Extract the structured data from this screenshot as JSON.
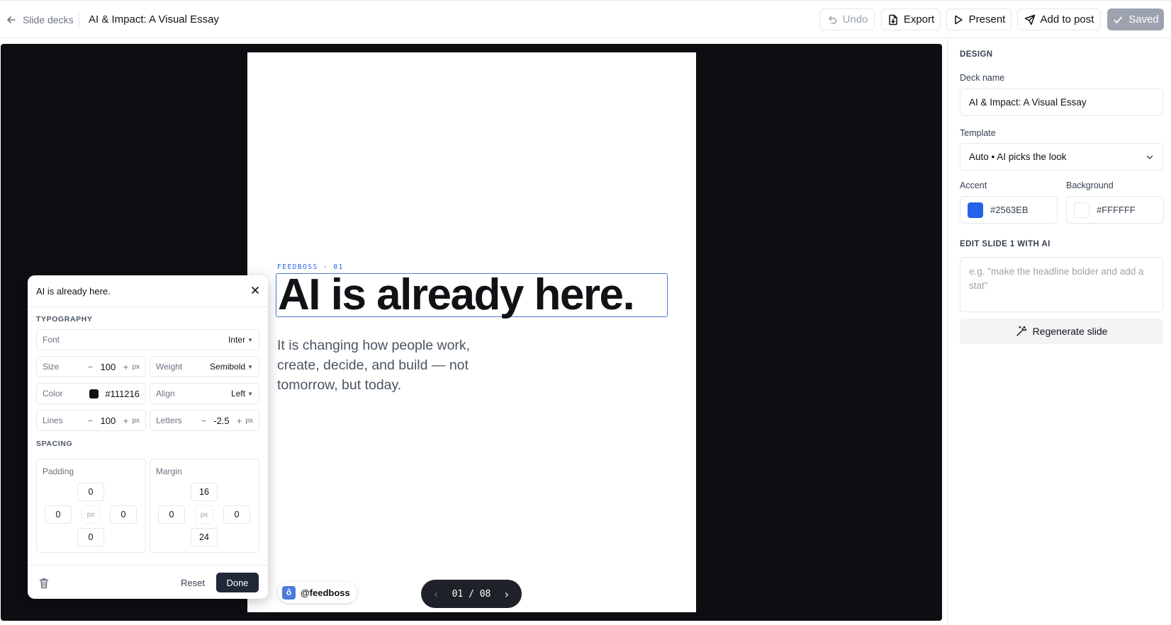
{
  "header": {
    "back_label": "Slide decks",
    "deck_title": "AI & Impact: A Visual Essay",
    "undo_label": "Undo",
    "export_label": "Export",
    "present_label": "Present",
    "add_to_post_label": "Add to post",
    "saved_label": "Saved"
  },
  "slide": {
    "eyebrow": "FEEDBOSS · 01",
    "headline": "AI is already here.",
    "subhead": "It is changing how people work, create, decide, and build — not tomorrow, but today.",
    "handle": "@feedboss",
    "handle_logo": "ô"
  },
  "pager": {
    "current": "01",
    "separator": "/",
    "total": "08",
    "prev": "‹",
    "next": "›"
  },
  "edit_panel": {
    "title": "AI is already here.",
    "typography_label": "TYPOGRAPHY",
    "font": {
      "label": "Font",
      "value": "Inter"
    },
    "size": {
      "label": "Size",
      "value": "100",
      "unit": "px"
    },
    "weight": {
      "label": "Weight",
      "value": "Semibold"
    },
    "color": {
      "label": "Color",
      "value": "#111216"
    },
    "align": {
      "label": "Align",
      "value": "Left"
    },
    "lines": {
      "label": "Lines",
      "value": "100",
      "unit": "px"
    },
    "letters": {
      "label": "Letters",
      "value": "-2.5",
      "unit": "px"
    },
    "spacing_label": "SPACING",
    "padding": {
      "label": "Padding",
      "top": "0",
      "left": "0",
      "right": "0",
      "bottom": "0",
      "unit": "px"
    },
    "margin": {
      "label": "Margin",
      "top": "16",
      "left": "0",
      "right": "0",
      "bottom": "24",
      "unit": "px"
    },
    "reset_label": "Reset",
    "done_label": "Done",
    "minus": "−",
    "plus": "+"
  },
  "sidebar": {
    "design_label": "DESIGN",
    "deck_name_label": "Deck name",
    "deck_name_value": "AI & Impact: A Visual Essay",
    "template_label": "Template",
    "template_value": "Auto • AI picks the look",
    "accent_label": "Accent",
    "accent_value": "#2563EB",
    "background_label": "Background",
    "background_value": "#FFFFFF",
    "edit_ai_label": "EDIT SLIDE 1 WITH AI",
    "edit_ai_placeholder": "e.g. \"make the headline bolder and add a stat\"",
    "regenerate_label": "Regenerate slide"
  },
  "colors": {
    "stage_bg": "#0d0e12",
    "accent": "#2563EB",
    "text": "#111216",
    "saved_bg": "#9ca3af"
  }
}
